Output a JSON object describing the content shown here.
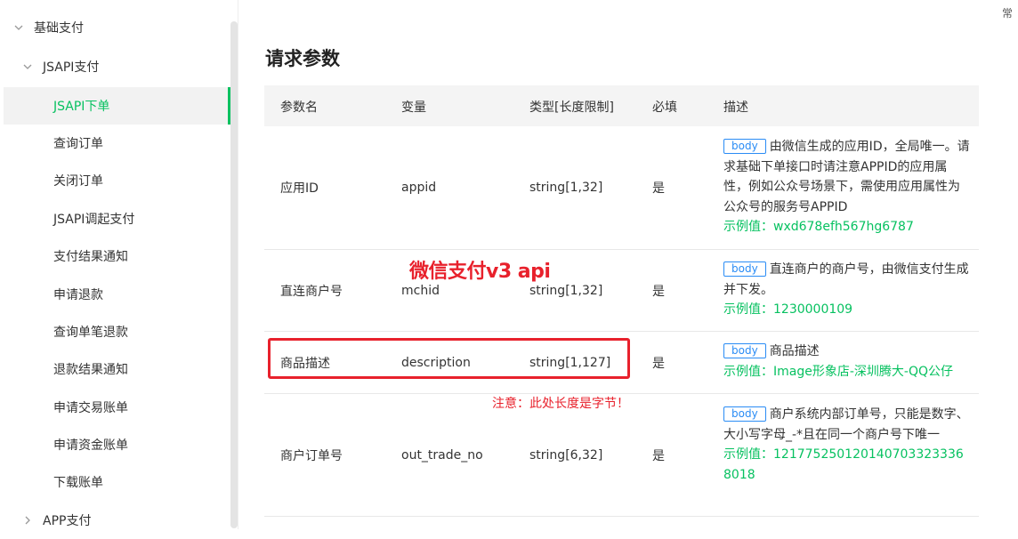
{
  "sidebar": {
    "items": [
      {
        "label": "基础支付",
        "level": 0,
        "expanded": true
      },
      {
        "label": "JSAPI支付",
        "level": 1,
        "expanded": true
      },
      {
        "label": "JSAPI下单",
        "level": 2,
        "active": true
      },
      {
        "label": "查询订单",
        "level": 2
      },
      {
        "label": "关闭订单",
        "level": 2
      },
      {
        "label": "JSAPI调起支付",
        "level": 2
      },
      {
        "label": "支付结果通知",
        "level": 2
      },
      {
        "label": "申请退款",
        "level": 2
      },
      {
        "label": "查询单笔退款",
        "level": 2
      },
      {
        "label": "退款结果通知",
        "level": 2
      },
      {
        "label": "申请交易账单",
        "level": 2
      },
      {
        "label": "申请资金账单",
        "level": 2
      },
      {
        "label": "下载账单",
        "level": 2
      },
      {
        "label": "APP支付",
        "level": 1,
        "expanded": false
      }
    ]
  },
  "main": {
    "title": "请求参数",
    "columns": [
      "参数名",
      "变量",
      "类型[长度限制]",
      "必填",
      "描述"
    ],
    "rows": [
      {
        "name": "应用ID",
        "var": "appid",
        "type": "string[1,32]",
        "required": "是",
        "badge": "body",
        "desc": "由微信生成的应用ID，全局唯一。请求基础下单接口时请注意APPID的应用属性，例如公众号场景下，需使用应用属性为公众号的服务号APPID",
        "example": "示例值：wxd678efh567hg6787"
      },
      {
        "name": "直连商户号",
        "var": "mchid",
        "type": "string[1,32]",
        "required": "是",
        "badge": "body",
        "desc": "直连商户的商户号，由微信支付生成并下发。",
        "example": "示例值：1230000109"
      },
      {
        "name": "商品描述",
        "var": "description",
        "type": "string[1,127]",
        "required": "是",
        "badge": "body",
        "desc": "商品描述",
        "example": "示例值：Image形象店-深圳腾大-QQ公仔"
      },
      {
        "name": "商户订单号",
        "var": "out_trade_no",
        "type": "string[6,32]",
        "required": "是",
        "badge": "body",
        "desc": "商户系统内部订单号，只能是数字、大小写字母_-*且在同一个商户号下唯一",
        "example": "示例值：1217752501201407033233368018"
      }
    ]
  },
  "annotations": {
    "title": "微信支付v3 api",
    "note": "注意：此处长度是字节！"
  },
  "edge_glyph": "常",
  "colors": {
    "accent": "#07c160",
    "badge": "#2a8cf5",
    "annotation": "#e8212c"
  }
}
